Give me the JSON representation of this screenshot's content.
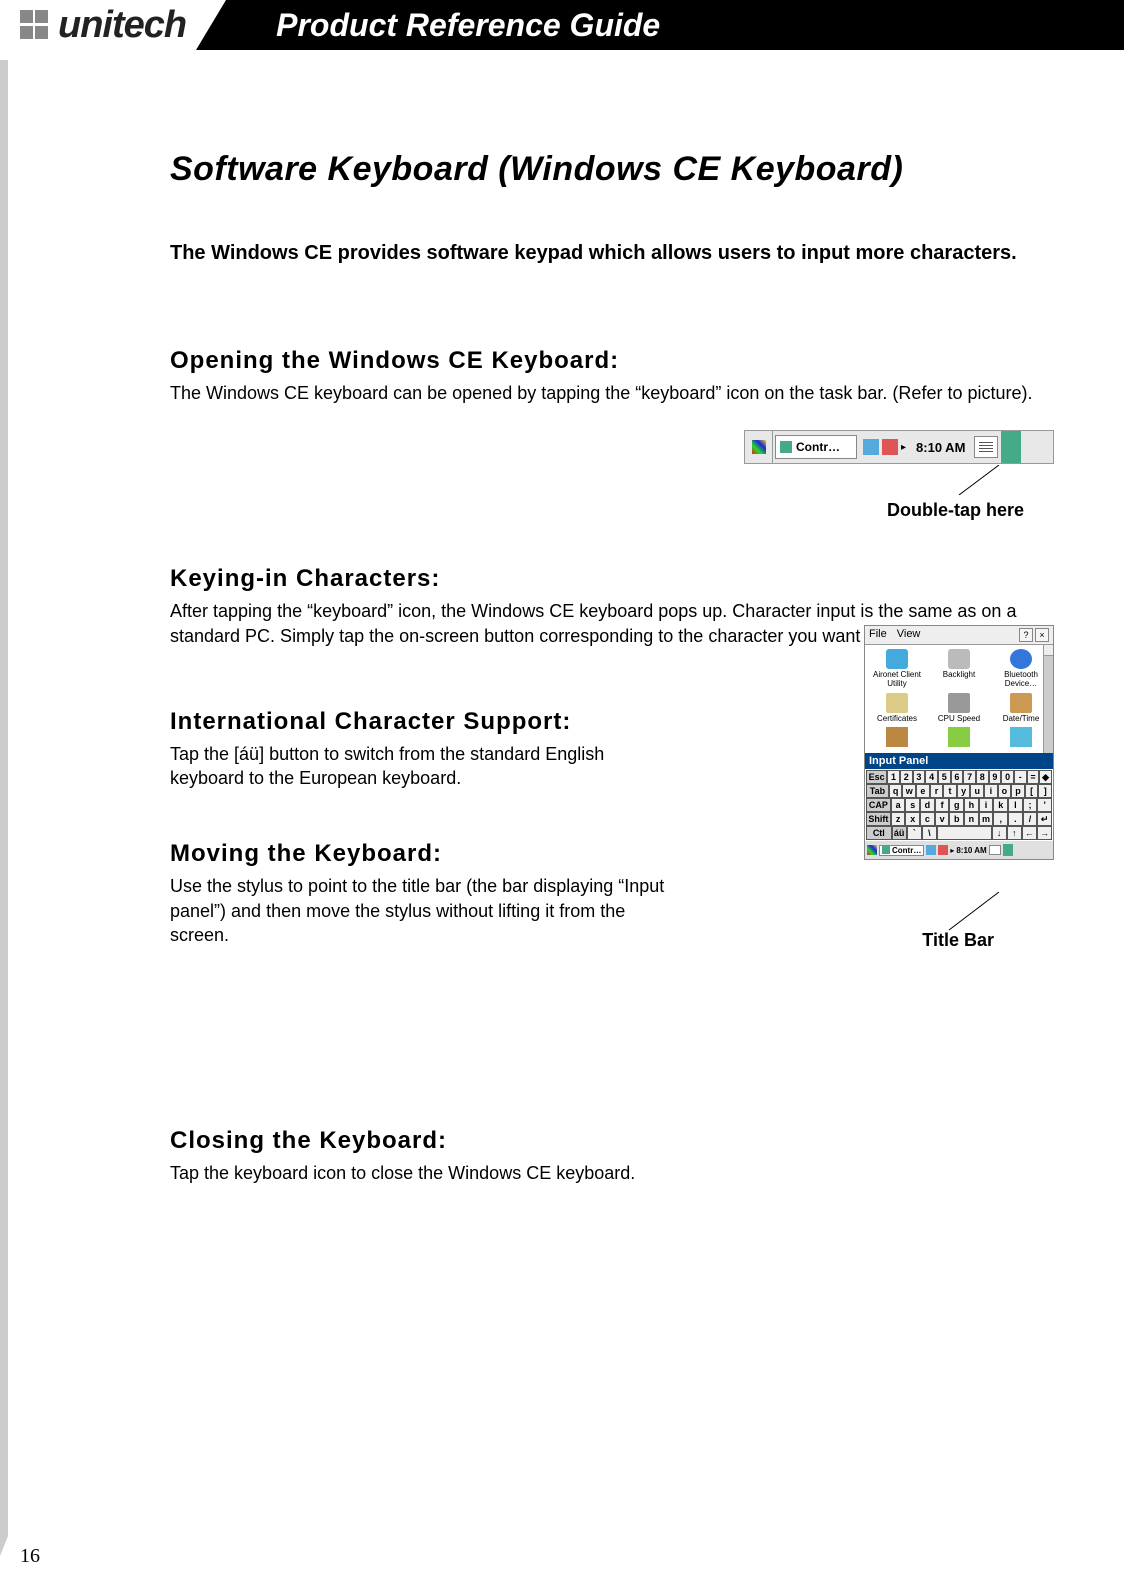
{
  "header": {
    "brand": "unitech",
    "title": "Product Reference Guide"
  },
  "page_title": "Software Keyboard (Windows CE Keyboard)",
  "intro": "The Windows CE provides software keypad which allows users to input more characters.",
  "sections": {
    "opening": {
      "title": "Opening the Windows CE Keyboard:",
      "body": "The Windows CE keyboard can be opened by tapping the “keyboard” icon on the task bar. (Refer to picture)."
    },
    "keying": {
      "title": "Keying-in Characters:",
      "body": "After tapping the “keyboard” icon, the Windows CE keyboard pops up. Character input is the same as on a standard PC. Simply tap the on-screen button corresponding to the character you want to input."
    },
    "intl": {
      "title": "International Character Support:",
      "body": "Tap the [áü] button to switch from the standard English keyboard to the European keyboard."
    },
    "moving": {
      "title": "Moving the Keyboard:",
      "body": "Use the stylus to point to the title bar (the bar displaying “Input panel”) and then move the stylus without lifting it from the screen."
    },
    "closing": {
      "title": "Closing the Keyboard:",
      "body": "Tap the keyboard icon to close the Windows CE keyboard."
    }
  },
  "taskbar": {
    "app_button": "Contr…",
    "arrow": "▸",
    "time": "8:10 AM"
  },
  "callouts": {
    "double_tap": "Double-tap here",
    "title_bar": "Title Bar"
  },
  "keyboard_panel": {
    "menu": {
      "file": "File",
      "view": "View",
      "help": "?",
      "close": "×"
    },
    "apps": [
      "Aironet Client Utility",
      "Backlight",
      "Bluetooth Device…",
      "Certificates",
      "CPU Speed",
      "Date/Time",
      "",
      "",
      ""
    ],
    "input_panel_title": "Input Panel",
    "rows": [
      [
        "Esc",
        "1",
        "2",
        "3",
        "4",
        "5",
        "6",
        "7",
        "8",
        "9",
        "0",
        "-",
        "=",
        "◆"
      ],
      [
        "Tab",
        "q",
        "w",
        "e",
        "r",
        "t",
        "y",
        "u",
        "i",
        "o",
        "p",
        "[",
        "]"
      ],
      [
        "CAP",
        "a",
        "s",
        "d",
        "f",
        "g",
        "h",
        "i",
        "k",
        "l",
        ";",
        "'"
      ],
      [
        "Shift",
        "z",
        "x",
        "c",
        "v",
        "b",
        "n",
        "m",
        ",",
        ".",
        "/",
        "↵"
      ],
      [
        "Ctl",
        "áü",
        "`",
        "\\",
        " ",
        "↓",
        "↑",
        "←",
        "→"
      ]
    ],
    "tb": {
      "contr": "Contr…",
      "arrow": "▸",
      "time": "8:10 AM"
    }
  },
  "page_number": "16"
}
